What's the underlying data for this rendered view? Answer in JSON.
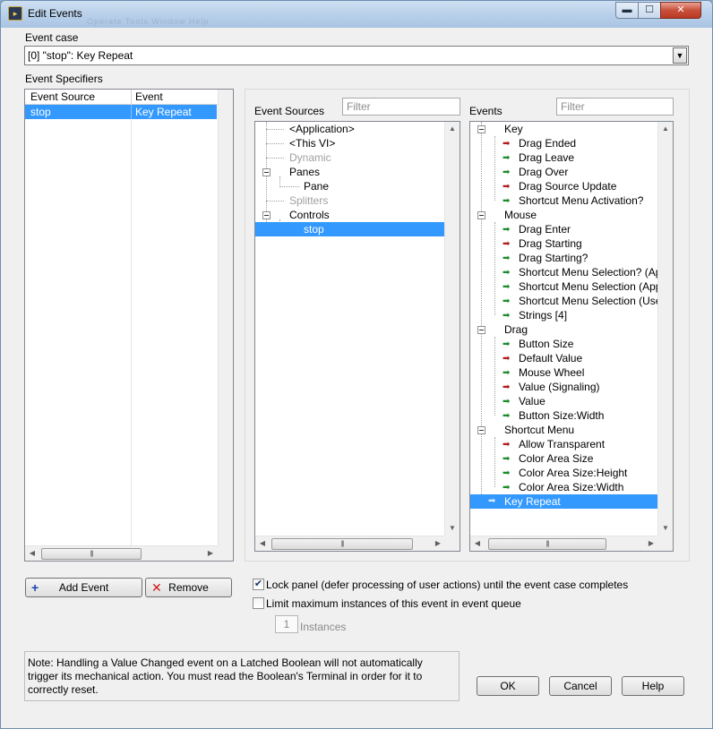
{
  "window": {
    "title": "Edit Events",
    "ghost_menu": "Operate   Tools   Window   Help",
    "minimize_glyph": "▬",
    "maximize_glyph": "☐",
    "close_glyph": "✕"
  },
  "event_case": {
    "label": "Event case",
    "value": "[0] \"stop\": Key Repeat"
  },
  "specifiers": {
    "label": "Event Specifiers",
    "columns": [
      "Event Source",
      "Event"
    ],
    "rows": [
      {
        "source": "stop",
        "event": "Key Repeat"
      }
    ]
  },
  "sources": {
    "label": "Event Sources",
    "filter_placeholder": "Filter",
    "items": [
      {
        "label": "<Application>",
        "disabled": false
      },
      {
        "label": "<This VI>",
        "disabled": false
      },
      {
        "label": "Dynamic",
        "disabled": true
      },
      {
        "label": "Panes",
        "disabled": false
      },
      {
        "label": "Pane",
        "disabled": false
      },
      {
        "label": "Splitters",
        "disabled": true
      },
      {
        "label": "Controls",
        "disabled": false
      },
      {
        "label": "stop",
        "disabled": false,
        "selected": true
      }
    ]
  },
  "events": {
    "label": "Events",
    "filter_placeholder": "Filter",
    "groups": [
      {
        "name": "Key",
        "items": [
          "Drag Ended",
          "Drag Leave",
          "Drag Over",
          "Drag Source Update",
          "Shortcut Menu Activation?"
        ]
      },
      {
        "name": "Mouse",
        "items": [
          "Drag Enter",
          "Drag Starting",
          "Drag Starting?",
          "Shortcut Menu Selection? (Ap",
          "Shortcut Menu Selection (App",
          "Shortcut Menu Selection (Use",
          "Strings [4]"
        ]
      },
      {
        "name": "Drag",
        "items": [
          "Button Size",
          "Default Value",
          "Mouse Wheel",
          "Value (Signaling)",
          "Value",
          "Button Size:Width"
        ]
      },
      {
        "name": "Shortcut Menu",
        "items": [
          "Allow Transparent",
          "Color Area Size",
          "Color Area Size:Height",
          "Color Area Size:Width"
        ]
      }
    ],
    "selected": "Key Repeat"
  },
  "buttons": {
    "add_event": "Add Event",
    "remove": "Remove",
    "ok": "OK",
    "cancel": "Cancel",
    "help": "Help"
  },
  "options": {
    "lock_panel": "Lock panel (defer processing of user actions) until the event case completes",
    "lock_checked": true,
    "limit_instances": "Limit maximum instances of this event in event queue",
    "limit_checked": false,
    "instances_value": "1",
    "instances_label": "Instances"
  },
  "note": "Note:  Handling a Value Changed event on a Latched Boolean will not automatically trigger its mechanical action. You must read the Boolean's Terminal in order for it to correctly reset.",
  "glyphs": {
    "scroll_left": "◀",
    "scroll_right": "▶",
    "scroll_up": "▲",
    "scroll_down": "▼",
    "thumb_grip": "|||",
    "arrow": "➡",
    "check": "✔",
    "plus": "+",
    "cross": "✕"
  },
  "colors": {
    "selection": "#3399ff",
    "arrow_red": "#b01a1a",
    "arrow_green": "#1a8a2a"
  }
}
